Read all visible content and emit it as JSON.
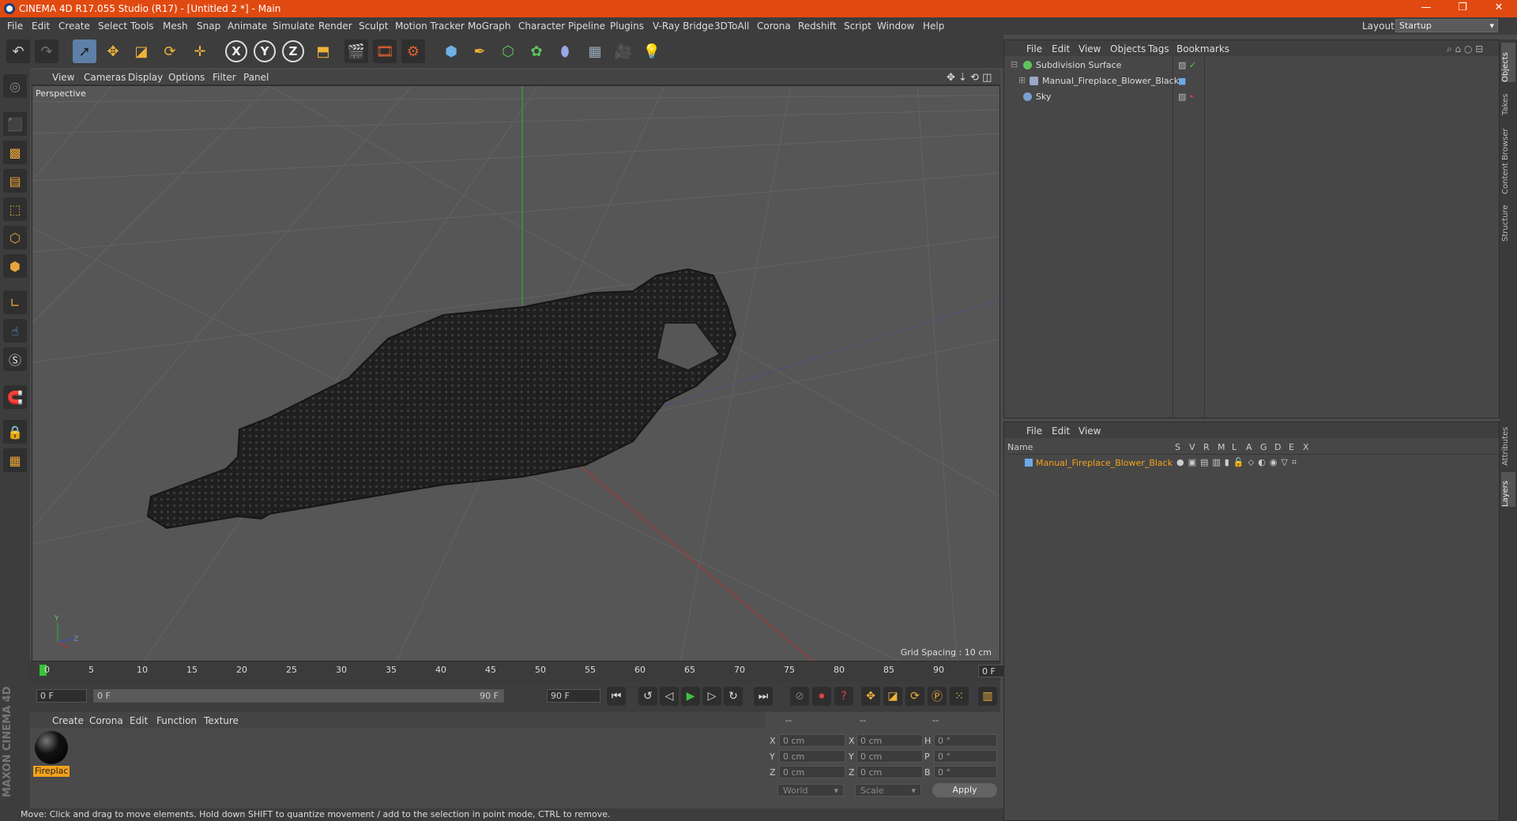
{
  "title_bar": {
    "title": "CINEMA 4D R17.055 Studio (R17) - [Untitled 2 *] - Main",
    "minimize": "—",
    "restore": "❐",
    "close": "✕"
  },
  "menu": [
    "File",
    "Edit",
    "Create",
    "Select",
    "Tools",
    "Mesh",
    "Snap",
    "Animate",
    "Simulate",
    "Render",
    "Sculpt",
    "Motion Tracker",
    "MoGraph",
    "Character",
    "Pipeline",
    "Plugins",
    "V-Ray Bridge",
    "3DToAll",
    "Corona",
    "Redshift",
    "Script",
    "Window",
    "Help"
  ],
  "layout": {
    "label": "Layout:",
    "value": "Startup"
  },
  "viewport": {
    "menu": [
      "View",
      "Cameras",
      "Display",
      "Options",
      "Filter",
      "Panel"
    ],
    "label": "Perspective",
    "grid_spacing": "Grid Spacing : 10 cm"
  },
  "timeline": {
    "ticks": [
      "0",
      "5",
      "10",
      "15",
      "20",
      "25",
      "30",
      "35",
      "40",
      "45",
      "50",
      "55",
      "60",
      "65",
      "70",
      "75",
      "80",
      "85",
      "90"
    ],
    "current_frame": "0 F",
    "start_field": "0 F",
    "range_start": "0 F",
    "range_end": "90 F",
    "end_field": "90 F"
  },
  "material_manager": {
    "menu": [
      "Create",
      "Corona",
      "Edit",
      "Function",
      "Texture"
    ],
    "material_name": "Fireplac"
  },
  "maxon_logo": "MAXON CINEMA 4D",
  "coordinates": {
    "headers": [
      "--",
      "--",
      "--"
    ],
    "rows": [
      {
        "a": "X",
        "av": "0 cm",
        "b": "X",
        "bv": "0 cm",
        "c": "H",
        "cv": "0 °"
      },
      {
        "a": "Y",
        "av": "0 cm",
        "b": "Y",
        "bv": "0 cm",
        "c": "P",
        "cv": "0 °"
      },
      {
        "a": "Z",
        "av": "0 cm",
        "b": "Z",
        "bv": "0 cm",
        "c": "B",
        "cv": "0 °"
      }
    ],
    "mode": "World",
    "scale": "Scale",
    "apply": "Apply"
  },
  "status": "Move: Click and drag to move elements. Hold down SHIFT to quantize movement / add to the selection in point mode, CTRL to remove.",
  "object_manager": {
    "menu": [
      "File",
      "Edit",
      "View",
      "Objects",
      "Tags",
      "Bookmarks"
    ],
    "objects": [
      {
        "name": "Subdivision Surface",
        "color": "#5fc45f"
      },
      {
        "name": "Manual_Fireplace_Blower_Black",
        "color": "#9aa7c8"
      },
      {
        "name": "Sky",
        "color": "#7aa0d0"
      }
    ]
  },
  "layer_manager": {
    "menu": [
      "File",
      "Edit",
      "View"
    ],
    "columns": [
      "Name",
      "S",
      "V",
      "R",
      "M",
      "L",
      "A",
      "G",
      "D",
      "E",
      "X"
    ],
    "layers": [
      {
        "name": "Manual_Fireplace_Blower_Black",
        "color": "#f4a21c"
      }
    ]
  },
  "right_tabs": [
    "Objects",
    "Takes",
    "Content Browser",
    "Structure",
    "Attributes",
    "Layers"
  ]
}
